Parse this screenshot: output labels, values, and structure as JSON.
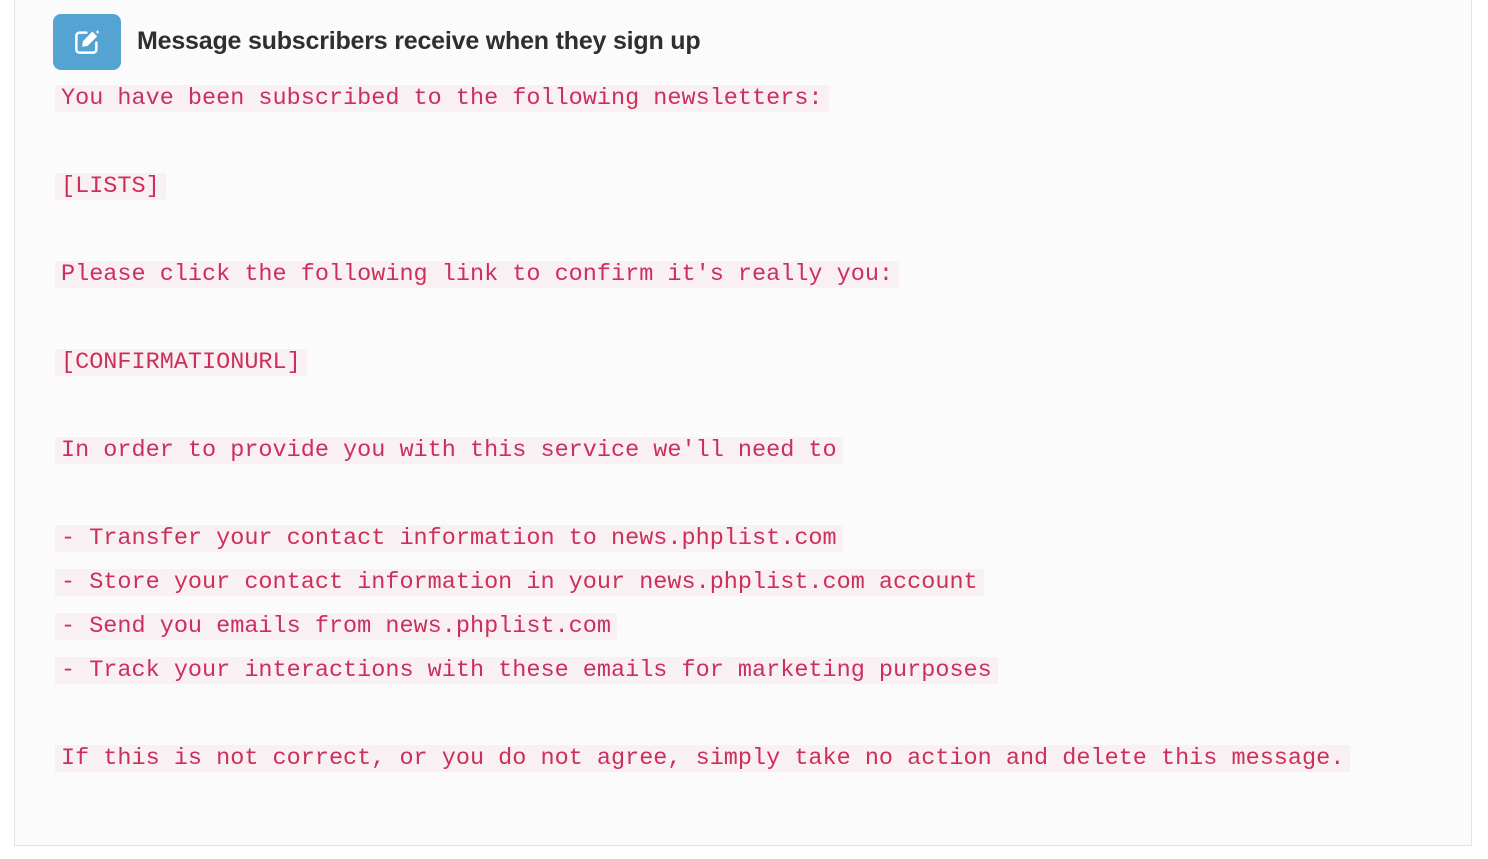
{
  "header": {
    "icon": "compose-message-icon",
    "icon_bg_color": "#54a3d3",
    "title": "Message subscribers receive when they sign up"
  },
  "colors": {
    "highlight_text": "#cc2f5c",
    "highlight_bg": "#f9f0f3",
    "panel_bg": "#fbfbfb",
    "panel_border": "#e4e4e4",
    "title_text": "#2f2f2f"
  },
  "message": {
    "blocks": [
      {
        "type": "text",
        "value": "You have been subscribed to the following newsletters:"
      },
      {
        "type": "blank",
        "value": ""
      },
      {
        "type": "text",
        "value": "[LISTS]"
      },
      {
        "type": "blank",
        "value": ""
      },
      {
        "type": "text",
        "value": "Please click the following link to confirm it's really you:"
      },
      {
        "type": "blank",
        "value": ""
      },
      {
        "type": "text",
        "value": "[CONFIRMATIONURL]"
      },
      {
        "type": "blank",
        "value": ""
      },
      {
        "type": "text",
        "value": "In order to provide you with this service we'll need to"
      },
      {
        "type": "blank",
        "value": ""
      },
      {
        "type": "text",
        "value": "- Transfer your contact information to news.phplist.com"
      },
      {
        "type": "text",
        "value": "- Store your contact information in your news.phplist.com account"
      },
      {
        "type": "text",
        "value": "- Send you emails from news.phplist.com"
      },
      {
        "type": "text",
        "value": "- Track your interactions with these emails for marketing purposes"
      },
      {
        "type": "blank",
        "value": ""
      },
      {
        "type": "text",
        "value": "If this is not correct, or you do not agree, simply take no action and delete this message."
      }
    ]
  }
}
